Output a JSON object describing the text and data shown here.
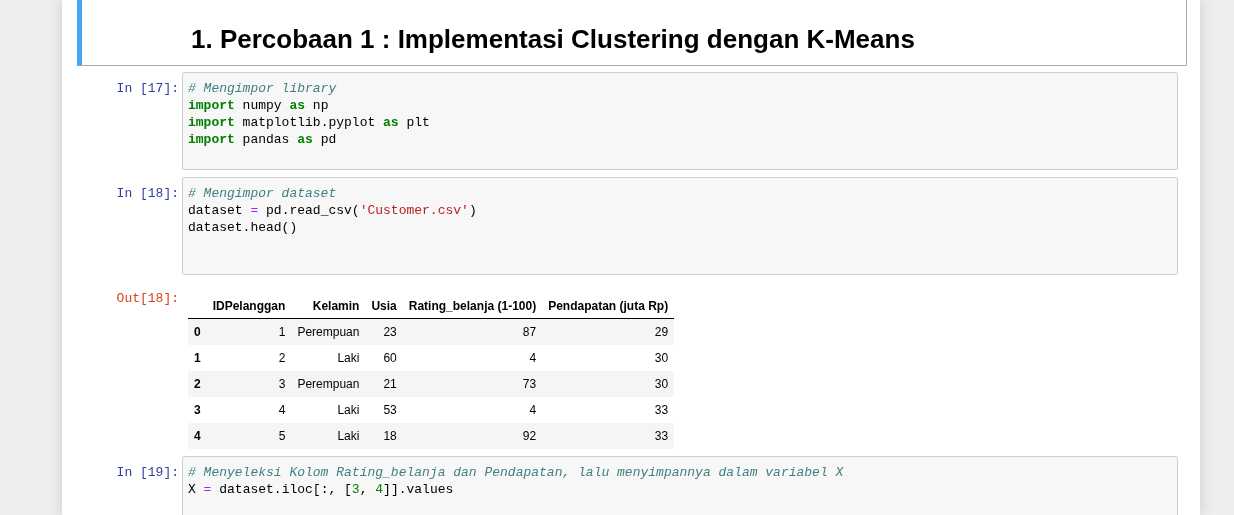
{
  "cells": [
    {
      "kind": "markdown",
      "selected": true,
      "heading": "1. Percobaan 1 : Implementasi Clustering dengan K-Means"
    },
    {
      "kind": "code",
      "selected": false,
      "prompt": "In [17]:",
      "lines": [
        [
          {
            "kind": "comment",
            "text": "# Mengimpor library"
          }
        ],
        [
          {
            "kind": "keyword",
            "text": "import"
          },
          {
            "kind": "plain",
            "text": " numpy "
          },
          {
            "kind": "keyword",
            "text": "as"
          },
          {
            "kind": "plain",
            "text": " np"
          }
        ],
        [
          {
            "kind": "keyword",
            "text": "import"
          },
          {
            "kind": "plain",
            "text": " matplotlib.pyplot "
          },
          {
            "kind": "keyword",
            "text": "as"
          },
          {
            "kind": "plain",
            "text": " plt"
          }
        ],
        [
          {
            "kind": "keyword",
            "text": "import"
          },
          {
            "kind": "plain",
            "text": " pandas "
          },
          {
            "kind": "keyword",
            "text": "as"
          },
          {
            "kind": "plain",
            "text": " pd"
          }
        ]
      ]
    },
    {
      "kind": "code",
      "selected": false,
      "prompt": "In [18]:",
      "lines": [
        [
          {
            "kind": "comment",
            "text": "# Mengimpor dataset"
          }
        ],
        [
          {
            "kind": "plain",
            "text": "dataset "
          },
          {
            "kind": "operator",
            "text": "="
          },
          {
            "kind": "plain",
            "text": " pd.read_csv("
          },
          {
            "kind": "string",
            "text": "'Customer.csv'"
          },
          {
            "kind": "plain",
            "text": ")"
          }
        ],
        [
          {
            "kind": "plain",
            "text": "dataset.head()"
          }
        ]
      ]
    },
    {
      "kind": "output",
      "prompt": "Out[18]:",
      "table": {
        "columns": [
          "IDPelanggan",
          "Kelamin",
          "Usia",
          "Rating_belanja (1-100)",
          "Pendapatan (juta Rp)"
        ],
        "rows": [
          {
            "index": "0",
            "cells": [
              "1",
              "Perempuan",
              "23",
              "87",
              "29"
            ]
          },
          {
            "index": "1",
            "cells": [
              "2",
              "Laki",
              "60",
              "4",
              "30"
            ]
          },
          {
            "index": "2",
            "cells": [
              "3",
              "Perempuan",
              "21",
              "73",
              "30"
            ]
          },
          {
            "index": "3",
            "cells": [
              "4",
              "Laki",
              "53",
              "4",
              "33"
            ]
          },
          {
            "index": "4",
            "cells": [
              "5",
              "Laki",
              "18",
              "92",
              "33"
            ]
          }
        ]
      }
    },
    {
      "kind": "code",
      "selected": false,
      "prompt": "In [19]:",
      "lines": [
        [
          {
            "kind": "comment",
            "text": "# Menyeleksi Kolom Rating_belanja dan Pendapatan, lalu menyimpannya dalam variabel X"
          }
        ],
        [
          {
            "kind": "plain",
            "text": "X "
          },
          {
            "kind": "operator",
            "text": "="
          },
          {
            "kind": "plain",
            "text": " dataset.iloc[:, ["
          },
          {
            "kind": "number",
            "text": "3"
          },
          {
            "kind": "plain",
            "text": ", "
          },
          {
            "kind": "number",
            "text": "4"
          },
          {
            "kind": "plain",
            "text": "]].values"
          }
        ]
      ]
    }
  ]
}
